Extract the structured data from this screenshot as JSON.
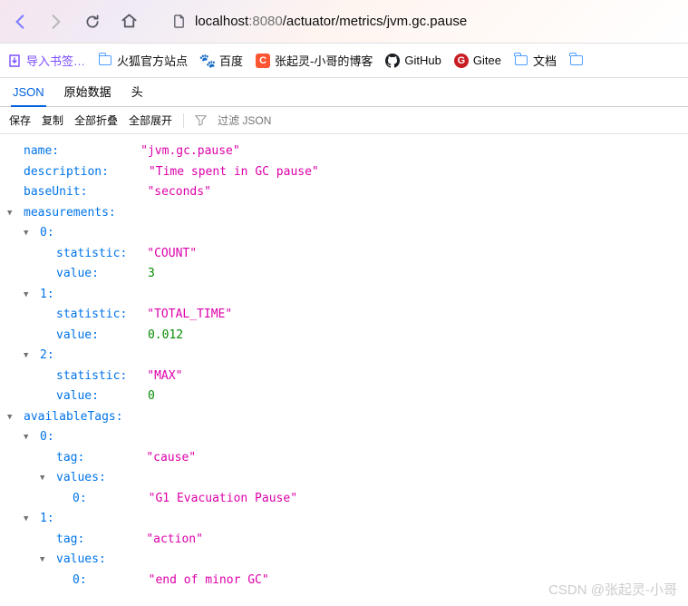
{
  "browser": {
    "url_host": "localhost",
    "url_port": ":8080",
    "url_path": "/actuator/metrics/jvm.gc.pause"
  },
  "bookmarks": {
    "import": "导入书签…",
    "firefox": "火狐官方站点",
    "baidu": "百度",
    "blog": "张起灵-小哥的博客",
    "github": "GitHub",
    "gitee": "Gitee",
    "docs": "文档"
  },
  "tabs": {
    "json": "JSON",
    "raw": "原始数据",
    "head": "头"
  },
  "toolbar": {
    "save": "保存",
    "copy": "复制",
    "collapse": "全部折叠",
    "expand": "全部展开",
    "filter_placeholder": "过滤 JSON"
  },
  "json": {
    "name_k": "name:",
    "name_v": "\"jvm.gc.pause\"",
    "desc_k": "description:",
    "desc_v": "\"Time spent in GC pause\"",
    "unit_k": "baseUnit:",
    "unit_v": "\"seconds\"",
    "meas_k": "measurements:",
    "i0": "0:",
    "i1": "1:",
    "i2": "2:",
    "stat_k": "statistic:",
    "val_k": "value:",
    "m0_stat": "\"COUNT\"",
    "m0_val": "3",
    "m1_stat": "\"TOTAL_TIME\"",
    "m1_val": "0.012",
    "m2_stat": "\"MAX\"",
    "m2_val": "0",
    "tags_k": "availableTags:",
    "tag_k": "tag:",
    "values_k": "values:",
    "t0_tag": "\"cause\"",
    "t0_v0": "\"G1 Evacuation Pause\"",
    "t1_tag": "\"action\"",
    "t1_v0": "\"end of minor GC\""
  },
  "watermark": "CSDN @张起灵-小哥"
}
